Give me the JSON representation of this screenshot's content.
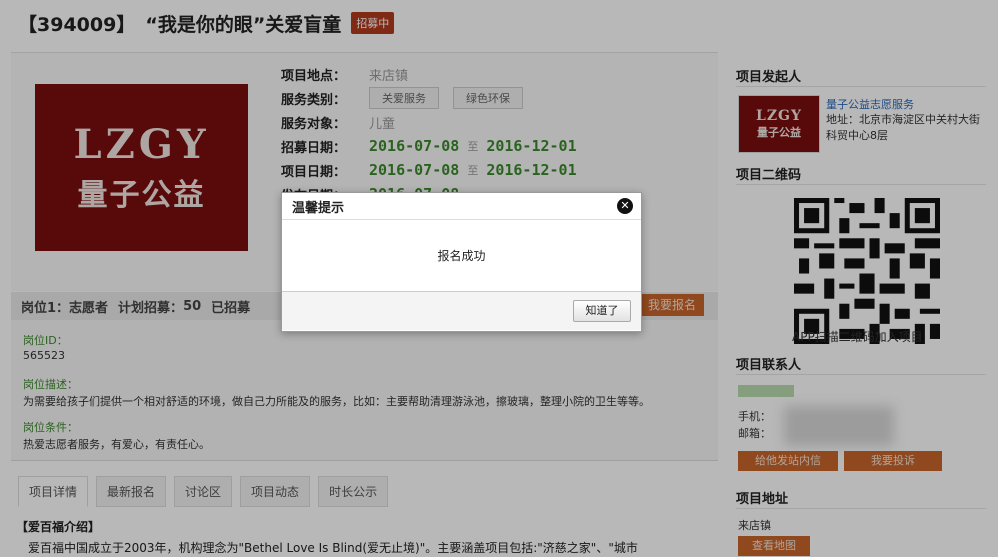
{
  "title": {
    "code": "【394009】",
    "name": "“我是你的眼”关爱盲童",
    "status": "招募中"
  },
  "logo": {
    "en": "LZGY",
    "cn": "量子公益"
  },
  "info": {
    "location_label": "项目地点：",
    "location_value": "来店镇",
    "service_type_label": "服务类别：",
    "service_tags": [
      "关爱服务",
      "绿色环保"
    ],
    "target_label": "服务对象：",
    "target_value": "儿童",
    "recruit_label": "招募日期：",
    "recruit_start": "2016-07-08",
    "recruit_end": "2016-12-01",
    "project_label": "项目日期：",
    "project_start": "2016-07-08",
    "project_end": "2016-12-01",
    "publish_label": "发布日期：",
    "publish_date": "2016-07-08",
    "to": "至"
  },
  "post": {
    "title": "岗位1：志愿者",
    "plan_label": "计划招募：",
    "plan_count": "50",
    "recruited_label": "已招募",
    "apply_button": "我要报名",
    "id_label": "岗位ID：",
    "id_value": "565523",
    "desc_label": "岗位描述：",
    "desc_value": "为需要给孩子们提供一个相对舒适的环境，做自己力所能及的服务，比如：主要帮助清理游泳池，擦玻璃，整理小院的卫生等等。",
    "cond_label": "岗位条件：",
    "cond_value": "热爱志愿者服务，有爱心，有责任心。"
  },
  "tabs": [
    "项目详情",
    "最新报名",
    "讨论区",
    "项目动态",
    "时长公示"
  ],
  "desc": {
    "heading": "【爱百福介绍】",
    "text": "爱百福中国成立于2003年，机构理念为\"Bethel Love Is Blind(爱无止境)\"。主要涵盖项目包括:\"济慈之家\"、\"城市"
  },
  "sidebar": {
    "initiator_heading": "项目发起人",
    "org_logo_en": "LZGY",
    "org_logo_cn": "量子公益",
    "org_name": "量子公益志愿服务",
    "org_address": "地址：北京市海淀区中关村大街科贸中心8层",
    "qr_heading": "项目二维码",
    "qr_caption": "APP扫描二维码加入项目",
    "contact_heading": "项目联系人",
    "phone_label": "手机：",
    "email_label": "邮箱：",
    "msg_button": "给他发站内信",
    "report_button": "我要投诉",
    "address_heading": "项目地址",
    "address_value": "来店镇",
    "map_button": "查看地图"
  },
  "dialog": {
    "title": "温馨提示",
    "message": "报名成功",
    "ok_button": "知道了",
    "close_icon": "close-icon"
  }
}
